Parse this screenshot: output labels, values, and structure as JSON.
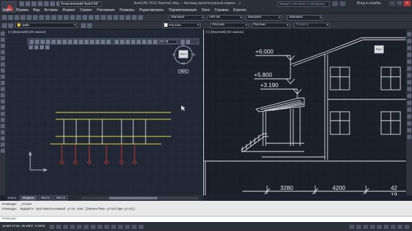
{
  "titlebar": {
    "workspace": "Классический AutoCAD",
    "title": "AutoCAD 2013    Чертеж1.dwg — Автокад (архитектурный подвал ...)",
    "search_placeholder": "Введите ключевое слово/фразу",
    "signin": "Вход в службы"
  },
  "menu": {
    "items": [
      "Файл",
      "Правка",
      "Вид",
      "Вставка",
      "Формат",
      "Сервис",
      "Рисование",
      "Размеры",
      "Редактировать",
      "Параметризация",
      "Окно",
      "Справка",
      "Express"
    ]
  },
  "toolbar1": {
    "textstyle": "Standard",
    "dimstyle": "ISO-25",
    "tablestyle": "Standard",
    "mleaderstyle": "Standard"
  },
  "toolbar2": {
    "layer_combo": "walls",
    "color_combo": "Послою",
    "linetype_combo": "Послою",
    "lineweight_combo": "Послою",
    "plotstyle_combo": "Поцвету"
  },
  "left_viewport": {
    "label": "[+] [Верхний] [2D каркас]",
    "dimstyle_combo": "ISO-25",
    "viewcube_label": "Верх",
    "compass_north": "С",
    "compass_south": "Ю",
    "compass_west": "З",
    "compass_east": "В",
    "wcs": "МСК"
  },
  "right_viewport": {
    "label": "[+] [Верхний] [2D каркас]",
    "viewcube_label": "Верх",
    "elevations": [
      "+6.000",
      "+5.800",
      "+3.190"
    ],
    "dimensions": [
      "3280",
      "4200",
      "42",
      "19"
    ]
  },
  "tabs": {
    "model": "Модель",
    "sheet1": "Лист1",
    "sheet2": "Лист2"
  },
  "command": {
    "line1": "Команда: _erase",
    "line2": "Команда: Задайте противоположный угол или [Линия/Рмн-угол/Сфн-угол]:",
    "prompt": "Команда:"
  },
  "status": {
    "coords": "16462.0745, 29.0807, 0.0000"
  },
  "colors": {
    "accent_yellow": "#e5e03a",
    "accent_red": "#d83a2e",
    "lines_white": "#e8eaf0"
  }
}
